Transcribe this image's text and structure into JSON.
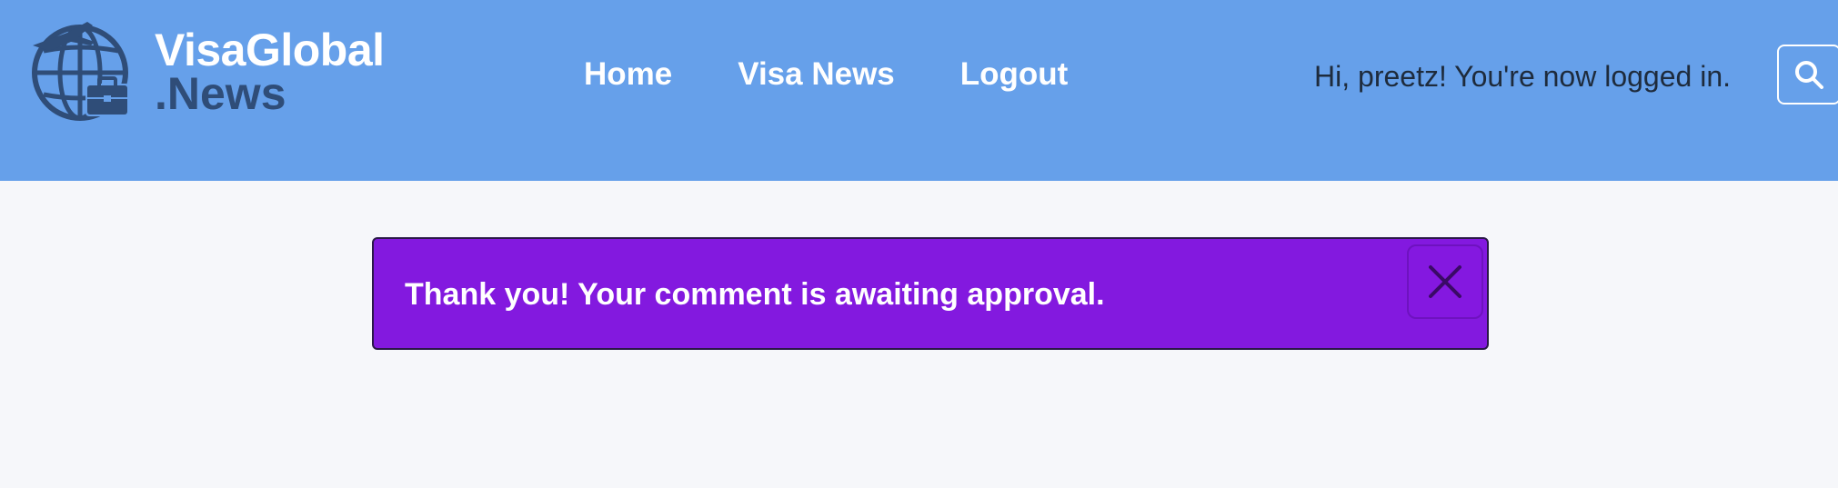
{
  "brand": {
    "name_line1": "VisaGlobal",
    "name_line2": ".News",
    "logo_icon": "globe-airplane-briefcase-icon"
  },
  "nav": {
    "items": [
      {
        "label": "Home"
      },
      {
        "label": "Visa News"
      },
      {
        "label": "Logout"
      }
    ]
  },
  "user": {
    "greeting": "Hi, preetz! You're now logged in."
  },
  "search": {
    "icon": "search-icon"
  },
  "alert": {
    "message": "Thank you! Your comment is awaiting approval.",
    "close_icon": "close-icon"
  },
  "colors": {
    "header_bg": "#66a0ea",
    "page_bg": "#f6f7fa",
    "alert_bg": "#8319df",
    "logo_dark": "#2f4d78"
  }
}
